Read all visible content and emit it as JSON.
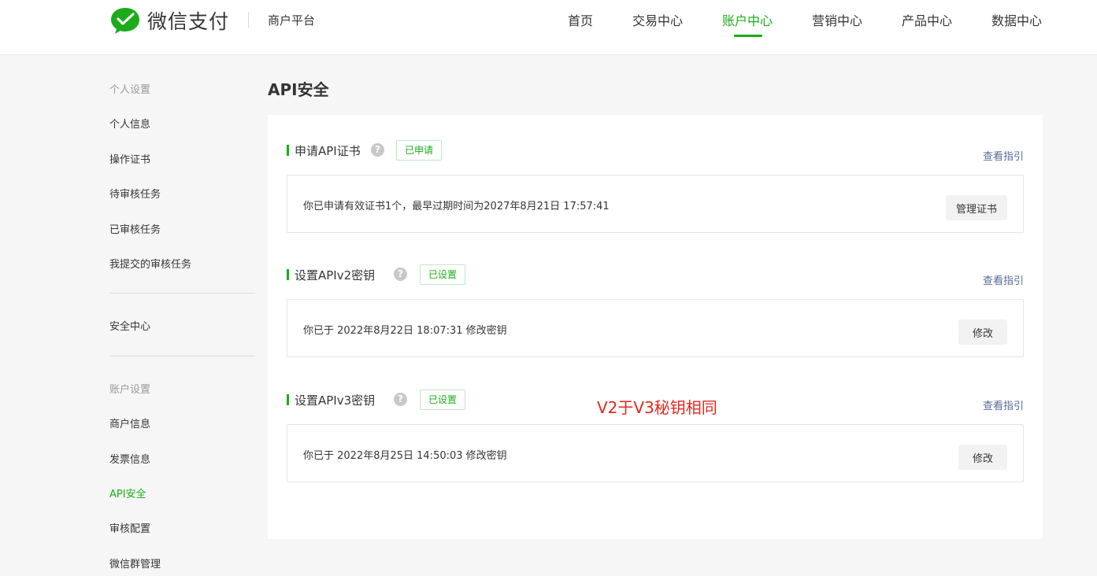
{
  "header": {
    "logo_text": "微信支付",
    "subtitle": "商户平台",
    "brand_color": "#1aad19",
    "nav": [
      "首页",
      "交易中心",
      "账户中心",
      "营销中心",
      "产品中心",
      "数据中心"
    ],
    "active_nav": "账户中心"
  },
  "sidebar": {
    "group_personal": "个人设置",
    "personal_items": [
      "个人信息",
      "操作证书",
      "待审核任务",
      "已审核任务",
      "我提交的审核任务"
    ],
    "security_center": "安全中心",
    "group_account": "账户设置",
    "account_items": [
      "商户信息",
      "发票信息",
      "API安全",
      "审核配置",
      "微信群管理"
    ],
    "active_item": "API安全"
  },
  "main": {
    "title": "API安全",
    "sections": [
      {
        "title": "申请API证书",
        "badge": "已申请",
        "guide": "查看指引",
        "desc": "你已申请有效证书1个，最早过期时间为2027年8月21日 17:57:41",
        "button": "管理证书"
      },
      {
        "title": "设置APIv2密钥",
        "badge": "已设置",
        "guide": "查看指引",
        "desc": "你已于 2022年8月22日 18:07:31 修改密钥",
        "button": "修改"
      },
      {
        "title": "设置APIv3密钥",
        "badge": "已设置",
        "guide": "查看指引",
        "desc": "你已于 2022年8月25日 14:50:03 修改密钥",
        "button": "修改"
      }
    ],
    "annotation": "V2于V3秘钥相同"
  },
  "icons": {
    "logo": "wechat-pay-logo-icon",
    "help": "question-mark-icon",
    "help_glyph": "?"
  }
}
